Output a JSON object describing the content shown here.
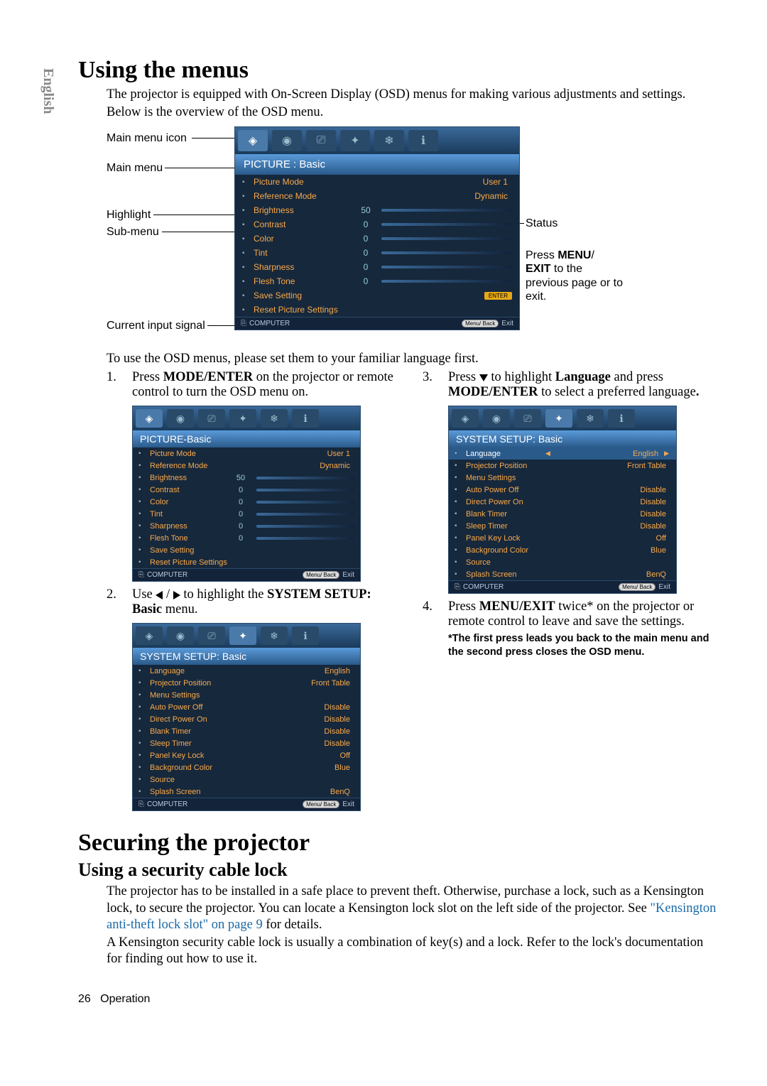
{
  "lang_tab": "English",
  "h1_menus": "Using the menus",
  "intro1": "The projector is equipped with On-Screen Display (OSD) menus for making various adjustments and settings.",
  "intro2": "Below is the overview of the OSD menu.",
  "callouts": {
    "main_icon": "Main menu icon",
    "main_menu": "Main menu",
    "highlight": "Highlight",
    "sub_menu": "Sub-menu",
    "current_input": "Current input signal",
    "status": "Status",
    "press_menu_exit": "Press ",
    "menu_bold": "MENU",
    "exit_bold": "EXIT",
    "to_prev": " to the previous page or to exit."
  },
  "osd_picture": {
    "title": "PICTURE : Basic",
    "title_small": "PICTURE-Basic",
    "rows": [
      {
        "label": "Picture Mode",
        "value": "",
        "text": "User 1"
      },
      {
        "label": "Reference Mode",
        "value": "",
        "text": "Dynamic"
      },
      {
        "label": "Brightness",
        "value": "50",
        "text": ""
      },
      {
        "label": "Contrast",
        "value": "0",
        "text": ""
      },
      {
        "label": "Color",
        "value": "0",
        "text": ""
      },
      {
        "label": "Tint",
        "value": "0",
        "text": ""
      },
      {
        "label": "Sharpness",
        "value": "0",
        "text": ""
      },
      {
        "label": "Flesh Tone",
        "value": "0",
        "text": ""
      },
      {
        "label": "Save Setting",
        "value": "",
        "text": ""
      },
      {
        "label": "Reset Picture Settings",
        "value": "",
        "text": ""
      }
    ],
    "enter": "ENTER",
    "footer_left": "COMPUTER",
    "footer_pill": "Menu/ Back",
    "footer_exit": "Exit"
  },
  "osd_system": {
    "title": "SYSTEM SETUP: Basic",
    "rows": [
      {
        "label": "Language",
        "text": "English",
        "hl": true
      },
      {
        "label": "Projector Position",
        "text": "Front Table"
      },
      {
        "label": "Menu Settings",
        "text": ""
      },
      {
        "label": "Auto Power Off",
        "text": "Disable"
      },
      {
        "label": "Direct Power On",
        "text": "Disable"
      },
      {
        "label": "Blank Timer",
        "text": "Disable"
      },
      {
        "label": "Sleep Timer",
        "text": "Disable"
      },
      {
        "label": "Panel Key Lock",
        "text": "Off"
      },
      {
        "label": "Background Color",
        "text": "Blue"
      },
      {
        "label": "Source",
        "text": ""
      },
      {
        "label": "Splash Screen",
        "text": "BenQ"
      }
    ],
    "footer_left": "COMPUTER",
    "footer_pill": "Menu/ Back",
    "footer_exit": "Exit"
  },
  "after_diagram": "To use the OSD menus, please set them to your familiar language first.",
  "steps": {
    "s1a": "Press ",
    "s1b": "MODE/ENTER",
    "s1c": " on the projector or remote control to turn the OSD menu on.",
    "s2a": "Use ",
    "s2b": " to highlight the ",
    "s2c": "SYSTEM SETUP: Basic",
    "s2d": " menu.",
    "s3a": "Press ",
    "s3b": " to highlight ",
    "s3c": "Language",
    "s3d": " and press ",
    "s3e": "MODE/ENTER",
    "s3f": " to select a preferred language",
    "s3g": ".",
    "s4a": "Press ",
    "s4b": "MENU/EXIT",
    "s4c": " twice* on the projector or remote control to leave and save the settings.",
    "note": "*The first press leads you back to the main menu and the second press closes the OSD menu."
  },
  "h1_secure": "Securing the projector",
  "h2_cable": "Using a security cable lock",
  "secure1a": "The projector has to be installed in a safe place to prevent theft. Otherwise, purchase a lock, such as a Kensington lock, to secure the projector. You can locate a Kensington lock slot on the left side of the projector. See ",
  "secure1_link": "\"Kensington anti-theft lock slot\" on page 9",
  "secure1b": " for details.",
  "secure2": "A Kensington security cable lock is usually a combination of key(s) and a lock. Refer to the lock's documentation for finding out how to use it.",
  "page_footer_num": "26",
  "page_footer_label": "Operation"
}
